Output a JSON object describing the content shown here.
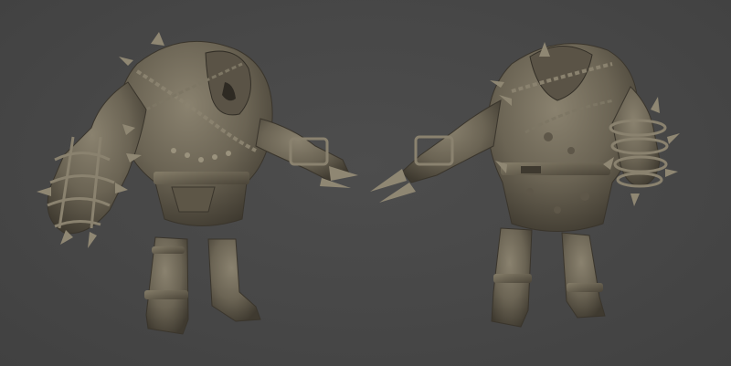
{
  "scene": {
    "background_color": "#474747",
    "model_color": "#6b6454",
    "model_shadow_color": "#3f3a30",
    "model_highlight_color": "#8a826f",
    "views": [
      {
        "id": "front",
        "icon": "creature-front-view"
      },
      {
        "id": "back",
        "icon": "creature-back-view"
      }
    ]
  }
}
